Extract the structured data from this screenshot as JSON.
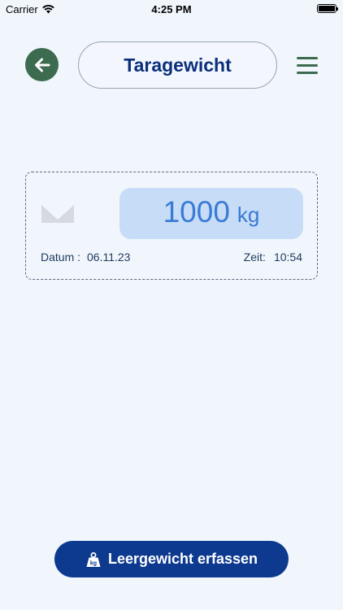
{
  "status_bar": {
    "carrier": "Carrier",
    "time": "4:25 PM"
  },
  "header": {
    "back_icon": "arrow-left-icon",
    "title": "Taragewicht",
    "menu_icon": "hamburger-menu-icon"
  },
  "record": {
    "scale_icon": "scale-icon",
    "weight_value": "1000",
    "weight_unit": "kg",
    "date_label": "Datum :",
    "date_value": "06.11.23",
    "time_label": "Zeit:",
    "time_value": "10:54"
  },
  "footer": {
    "button_icon": "weight-kg-icon",
    "button_label": "Leergewicht erfassen"
  },
  "colors": {
    "background": "#f1f6fd",
    "accent_green": "#3d6b4f",
    "brand_blue": "#0d3a8f",
    "weight_box": "#c7dcf7",
    "weight_text": "#3a7bd5"
  }
}
